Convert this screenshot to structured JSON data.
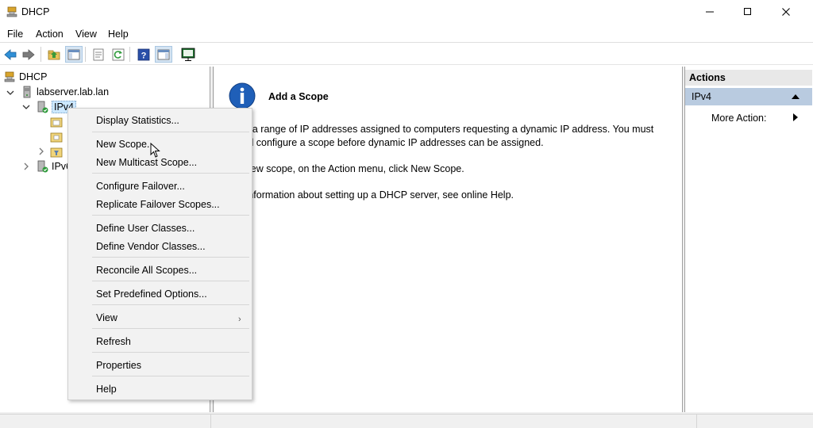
{
  "window": {
    "title": "DHCP",
    "controls": [
      "minimize",
      "maximize",
      "close"
    ]
  },
  "menu": [
    "File",
    "Action",
    "View",
    "Help"
  ],
  "toolbar": {
    "buttons": [
      "back-icon",
      "forward-icon",
      "up-folder-icon",
      "show-hide-tree-icon",
      "export-list-icon",
      "refresh-icon",
      "help-icon",
      "show-action-pane-icon",
      "monitor-icon"
    ]
  },
  "tree": {
    "root": "DHCP",
    "server": "labserver.lab.lan",
    "ipv4": "IPv4",
    "ipv6": "IPv6"
  },
  "content": {
    "title": "Add a Scope",
    "para1_line1": "pe is a range of IP addresses assigned to computers requesting a dynamic IP address. You must",
    "para1_line2": "e and configure a scope before dynamic IP addresses can be assigned.",
    "para2": "d a new scope, on the Action menu, click New Scope.",
    "para3": "ore information about setting up a DHCP server, see online Help."
  },
  "actions": {
    "header": "Actions",
    "group": "IPv4",
    "more": "More Action:"
  },
  "context_menu": {
    "items": [
      "Display Statistics...",
      "New Scope...",
      "New Multicast Scope...",
      "Configure Failover...",
      "Replicate Failover Scopes...",
      "Define User Classes...",
      "Define Vendor Classes...",
      "Reconcile All Scopes...",
      "Set Predefined Options...",
      "View",
      "Refresh",
      "Properties",
      "Help"
    ],
    "submenu_arrow": "›"
  },
  "colors": {
    "selection": "#cce8ff",
    "actions_group": "#b9cbe0",
    "info_blue": "#1f5fb8"
  }
}
